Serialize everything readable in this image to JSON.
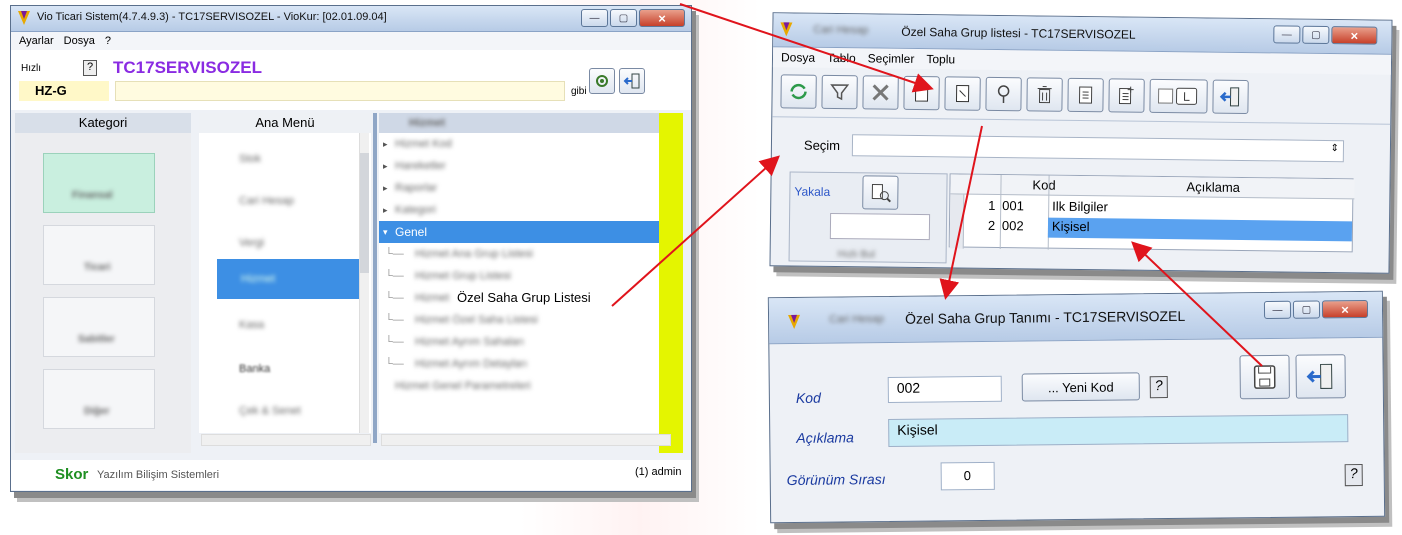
{
  "main_window": {
    "title": "Vio Ticari Sistem(4.7.4.9.3)  - TC17SERVISOZEL - VioKur: [02.01.09.04]",
    "menu": [
      "Ayarlar",
      "Dosya",
      "?"
    ],
    "quick_label": "Hızlı",
    "help_glyph": "?",
    "company": "TC17SERVISOZEL",
    "hz_code": "HZ-G",
    "search_suffix": "gibi",
    "col_headers": {
      "kategori": "Kategori",
      "ana_menu": "Ana Menü"
    },
    "tree_header": "Hizmet",
    "categories": [
      "Finansal",
      "Ticari",
      "Sabitler",
      "Diğer"
    ],
    "ana_menu_items": [
      "Stok",
      "Cari Hesap",
      "Vergi",
      "Hizmet",
      "Kasa",
      "Banka",
      "Çek & Senet"
    ],
    "tree_items": [
      {
        "label": "Hizmet Kod",
        "level": 0,
        "expander": "▸"
      },
      {
        "label": "Hareketler",
        "level": 0,
        "expander": "▸"
      },
      {
        "label": "Raporlar",
        "level": 0,
        "expander": "▸"
      },
      {
        "label": "Kategori",
        "level": 0,
        "expander": "▸"
      },
      {
        "label": "Genel",
        "level": 0,
        "expander": "▾",
        "selected": true
      },
      {
        "label": "Hizmet Ana Grup Listesi",
        "level": 1
      },
      {
        "label": "Hizmet Grup Listesi",
        "level": 1
      },
      {
        "label": "Özel Saha Grup Listesi",
        "level": 1,
        "prefix": "Hizmet",
        "sharp": true
      },
      {
        "label": "Hizmet Özel Saha Listesi",
        "level": 1
      },
      {
        "label": "Hizmet Ayrım Sahaları",
        "level": 1
      },
      {
        "label": "Hizmet Ayrım Detayları",
        "level": 1
      },
      {
        "label": "Hizmet Genel Parametreleri",
        "level": 0
      }
    ],
    "footer_brand": "Skor",
    "footer_text": "Yazılım Bilişim Sistemleri",
    "footer_user": "(1) admin"
  },
  "list_window": {
    "title": "Özel Saha Grup listesi - TC17SERVISOZEL",
    "title_prefix": "Cari Hesap",
    "menu": [
      "Dosya",
      "Tablo",
      "Seçimler",
      "Toplu"
    ],
    "secim_label": "Seçim",
    "yakala_label": "Yakala",
    "hizli_label": "Hızlı Bul",
    "columns": [
      "Kod",
      "Açıklama"
    ],
    "rows": [
      {
        "n": "1",
        "kod": "001",
        "aciklama": "Ilk Bilgiler"
      },
      {
        "n": "2",
        "kod": "002",
        "aciklama": "Kişisel",
        "selected": true
      }
    ]
  },
  "form_window": {
    "title": "Özel Saha Grup Tanımı - TC17SERVISOZEL",
    "title_prefix": "Cari Hesap",
    "kod_label": "Kod",
    "kod_value": "002",
    "yeni_kod_label": "... Yeni Kod",
    "aciklama_label": "Açıklama",
    "aciklama_value": "Kişisel",
    "sira_label": "Görünüm Sırası",
    "sira_value": "0",
    "help_glyph": "?"
  },
  "colors": {
    "arrow": "#e0141c",
    "selection": "#3d8fe4",
    "accent_purple": "#8a2be2",
    "yellow_bar": "#e4f500"
  }
}
